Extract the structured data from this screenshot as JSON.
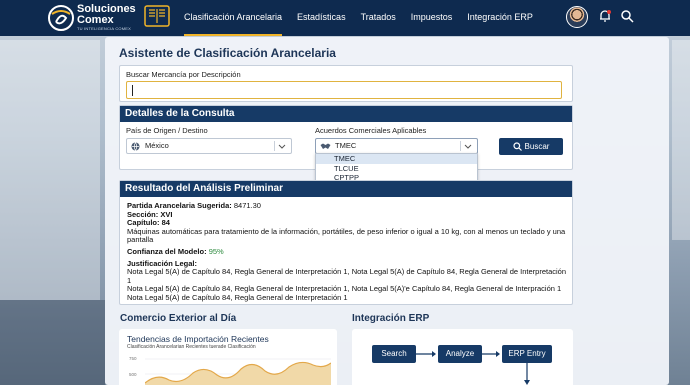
{
  "brand": {
    "line1": "Soluciones",
    "line2": "Comex",
    "tagline": "TU INTELIGENCIA COMEX"
  },
  "nav": [
    {
      "label": "Clasificación Arancelaria",
      "active": true
    },
    {
      "label": "Estadísticas"
    },
    {
      "label": "Tratados"
    },
    {
      "label": "Impuestos"
    },
    {
      "label": "Integración ERP"
    }
  ],
  "header_icons": {
    "avatar": "user-avatar",
    "notifications": "bell-icon",
    "search": "search-icon"
  },
  "page_title": "Asistente de Clasificación Arancelaria",
  "search": {
    "label": "Buscar Mercancía por Descripción",
    "value": ""
  },
  "consulta": {
    "title": "Detalles de la Consulta",
    "country_label": "País de Origen / Destino",
    "country_value": "México",
    "acuerdos_label": "Acuerdos Comerciales Aplicables",
    "acuerdos_value": "TMEC",
    "acuerdos_options": [
      "TMEC",
      "TLCUE",
      "CPTPP"
    ],
    "search_button": "Buscar"
  },
  "resultado": {
    "title": "Resultado del Análisis Preliminar",
    "partida_label": "Partida Arancelaria Sugerida:",
    "partida_value": "8471.30",
    "seccion": "Sección: XVI",
    "capitulo": "Capítulo: 84",
    "descripcion": "Máquinas automáticas para tratamiento de la información, portátiles, de peso inferior o igual a 10 kg, con al menos un teclado y una pantalla",
    "confianza_label": "Confianza del Modelo:",
    "confianza_value": "95%",
    "justificacion_label": "Justificación Legal:",
    "justificacion_lines": [
      "Nota Legal 5(A) de Capítulo 84, Regla General de Interpretación 1, Nota Legal 5(A) de Capítulo 84, Regla General de Interpretación 1",
      "Nota Legal 5(A) de Capítulo 84, Regla General de Interpretación 1, Nota Legal 5(A)'e Capítulo 84, Regla General de Interpración 1",
      "Nota Legal 5(A) de Capítulo 84, Regla General de Interpretación 1"
    ]
  },
  "comercio": {
    "title": "Comercio Exterior al Día",
    "chart_title": "Tendencias de Importación Recientes",
    "chart_subtitle": "Clasificación Arancelarian Recientes tuerade Clasificación",
    "y_ticks": [
      "750",
      "500"
    ]
  },
  "erp": {
    "title": "Integración ERP",
    "steps": [
      "Search",
      "Analyze",
      "ERP Entry"
    ]
  }
}
